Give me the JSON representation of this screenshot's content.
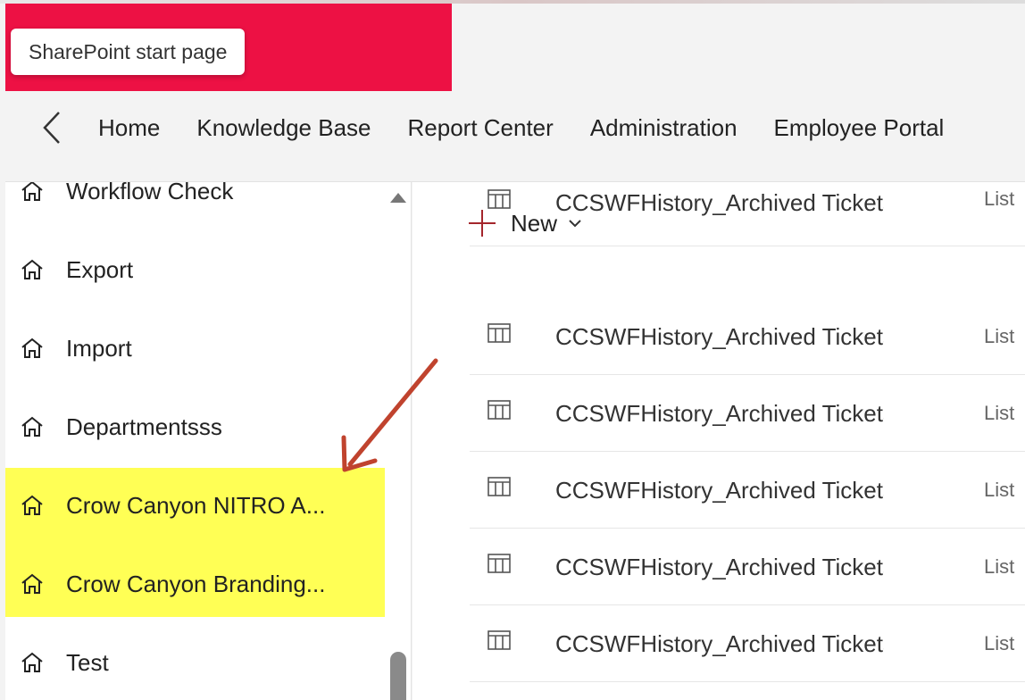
{
  "tooltip": {
    "text": "SharePoint start page"
  },
  "nav": {
    "links": [
      "Home",
      "Knowledge Base",
      "Report Center",
      "Administration",
      "Employee Portal"
    ]
  },
  "sidebar": {
    "items": [
      {
        "label": "Workflow Check",
        "icon": "home-icon"
      },
      {
        "label": "Export",
        "icon": "home-icon"
      },
      {
        "label": "Import",
        "icon": "home-icon"
      },
      {
        "label": "Departmentsss",
        "icon": "home-icon"
      },
      {
        "label": "Crow Canyon NITRO A...",
        "icon": "home-icon"
      },
      {
        "label": "Crow Canyon Branding...",
        "icon": "home-icon"
      },
      {
        "label": "Test",
        "icon": "home-icon"
      }
    ]
  },
  "toolbar": {
    "new_label": "New"
  },
  "list": {
    "rows": [
      {
        "name": "CCSWFHistory_Archived Tickets",
        "type": "List"
      },
      {
        "name": "CCSWFHistory_Archived Tickets",
        "type": "List"
      },
      {
        "name": "CCSWFHistory_Archived Tickets",
        "type": "List"
      },
      {
        "name": "CCSWFHistory_Archived Tickets",
        "type": "List"
      },
      {
        "name": "CCSWFHistory_Archived Tickets",
        "type": "List"
      },
      {
        "name": "CCSWFHistory_Archived Tickets",
        "type": "List"
      }
    ]
  },
  "colors": {
    "brand": "#ed1144",
    "highlight": "#ffff55",
    "annotation_arrow": "#c0432e",
    "new_plus": "#a4262c"
  }
}
